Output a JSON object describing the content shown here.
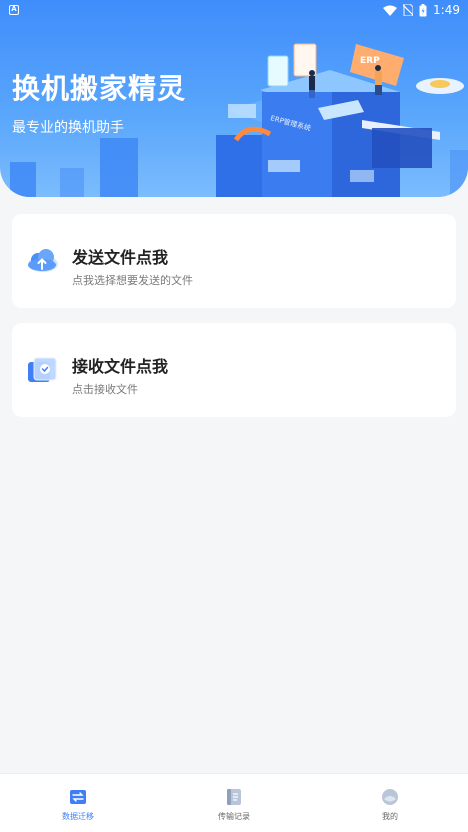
{
  "status_bar": {
    "time": "1:49",
    "icons": [
      "wifi-icon",
      "no-sim-icon",
      "battery-icon"
    ]
  },
  "hero": {
    "title": "换机搬家精灵",
    "subtitle": "最专业的换机助手",
    "art_labels": [
      "ERP",
      "ERP管理系统"
    ]
  },
  "cards": [
    {
      "title": "发送文件点我",
      "description": "点我选择想要发送的文件",
      "icon": "cloud-upload-icon"
    },
    {
      "title": "接收文件点我",
      "description": "点击接收文件",
      "icon": "receive-file-icon"
    }
  ],
  "bottom_nav": {
    "items": [
      {
        "label": "数据迁移",
        "icon": "data-migration-icon",
        "active": true
      },
      {
        "label": "传输记录",
        "icon": "transfer-record-icon",
        "active": false
      },
      {
        "label": "我的",
        "icon": "profile-icon",
        "active": false
      }
    ]
  },
  "colors": {
    "primary": "#3f8dfb",
    "active_tab": "#3f7ef5",
    "background": "#f5f6f8"
  }
}
